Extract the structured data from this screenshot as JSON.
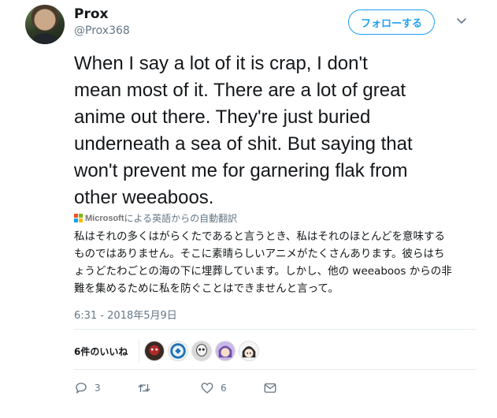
{
  "user": {
    "display_name": "Prox",
    "handle": "@Prox368"
  },
  "follow_button": {
    "label": "フォローする"
  },
  "tweet": {
    "text": "When I say a lot of it is crap, I don't\nmean most of it. There are a lot of great\nanime out there. They're just buried\nunderneath a sea of shit. But saying that\nwon't prevent me for garnering flak from\nother weeaboos."
  },
  "translation": {
    "brand": "Microsoft",
    "label": "による英語からの自動翻訳",
    "text": "私はそれの多くはがらくたであると言うとき、私はそれのほとんどを意味する\nものではありません。そこに素晴らしいアニメがたくさんあります。彼らはち\nょうどたわごとの海の下に埋葬しています。しかし、他の weeaboos からの非\n難を集めるために私を防ぐことはできませんと言って。",
    "logo_colors": [
      "#f25022",
      "#7fba00",
      "#00a4ef",
      "#ffb900"
    ]
  },
  "timestamp": "6:31 - 2018年5月9日",
  "likes": {
    "label": "6件のいいね",
    "avatar_icons": [
      "liker-avatar-1",
      "liker-avatar-2",
      "liker-avatar-3",
      "liker-avatar-4",
      "liker-avatar-5"
    ]
  },
  "actions": {
    "reply_count": "3",
    "retweet_count": "",
    "like_count": "6"
  },
  "colors": {
    "accent": "#1da1f2",
    "text": "#14171a",
    "secondary": "#657786",
    "divider": "#e6ecf0"
  }
}
